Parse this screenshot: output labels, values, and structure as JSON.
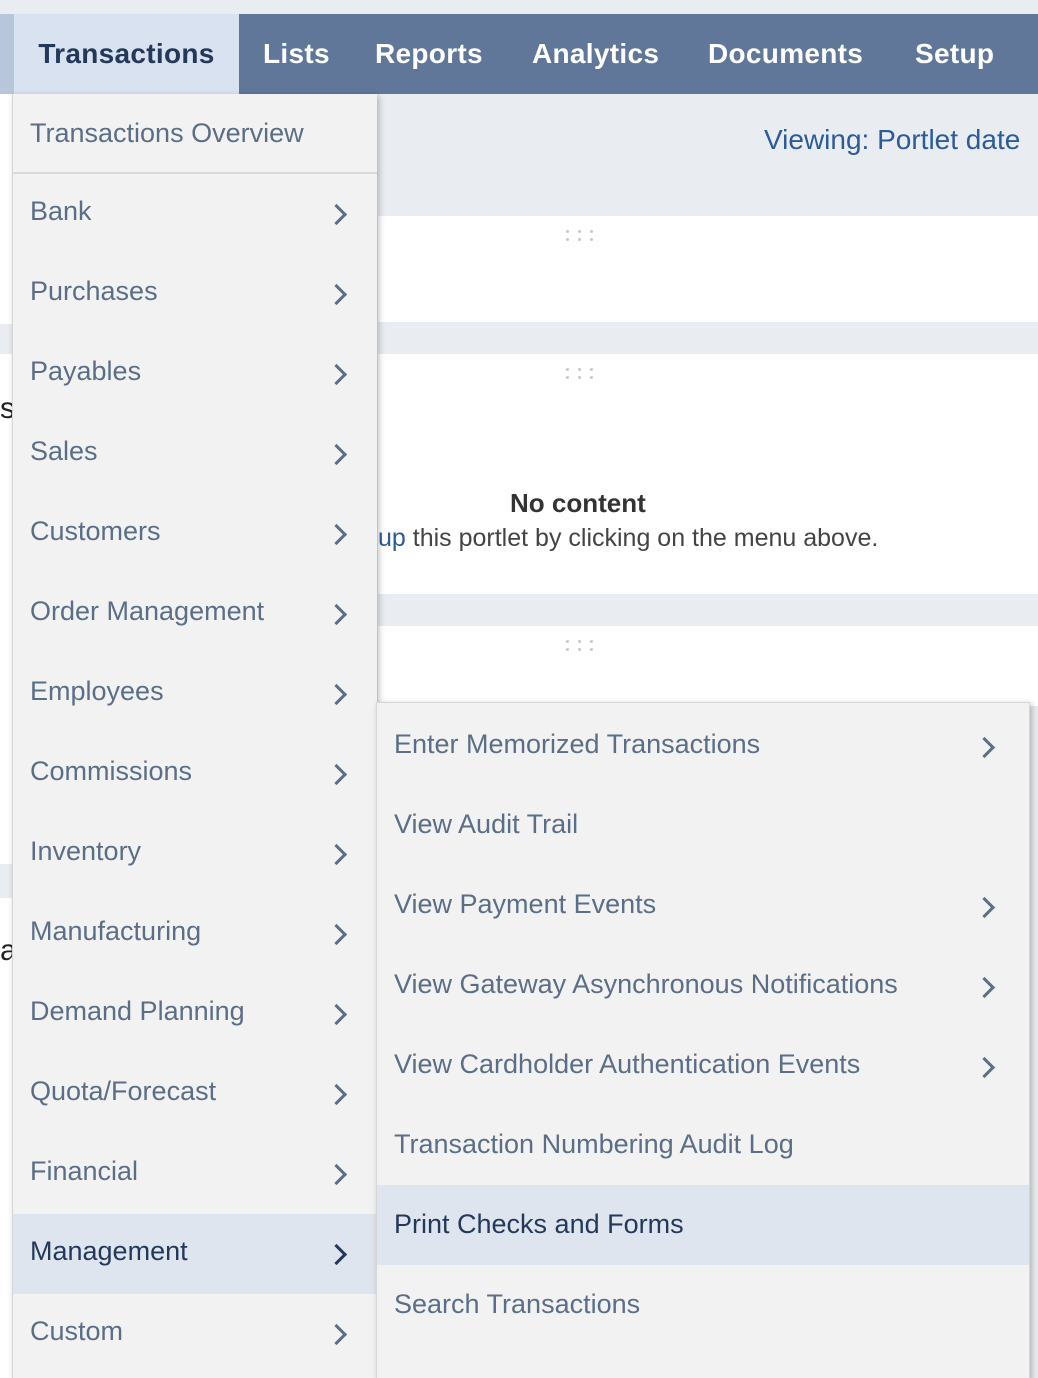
{
  "nav": {
    "tabs": [
      "Transactions",
      "Lists",
      "Reports",
      "Analytics",
      "Documents",
      "Setup"
    ],
    "active_tab": "Transactions"
  },
  "dashboard": {
    "viewing_label": "Viewing: Portlet date",
    "no_content_title": "No content",
    "hint_link_fragment": "up",
    "hint_text": " this portlet by clicking on the menu above."
  },
  "transactions_menu": {
    "overview": "Transactions Overview",
    "items": [
      {
        "label": "Bank",
        "has_submenu": true
      },
      {
        "label": "Purchases",
        "has_submenu": true
      },
      {
        "label": "Payables",
        "has_submenu": true
      },
      {
        "label": "Sales",
        "has_submenu": true
      },
      {
        "label": "Customers",
        "has_submenu": true
      },
      {
        "label": "Order Management",
        "has_submenu": true
      },
      {
        "label": "Employees",
        "has_submenu": true
      },
      {
        "label": "Commissions",
        "has_submenu": true
      },
      {
        "label": "Inventory",
        "has_submenu": true
      },
      {
        "label": "Manufacturing",
        "has_submenu": true
      },
      {
        "label": "Demand Planning",
        "has_submenu": true
      },
      {
        "label": "Quota/Forecast",
        "has_submenu": true
      },
      {
        "label": "Financial",
        "has_submenu": true
      },
      {
        "label": "Management",
        "has_submenu": true,
        "selected": true
      },
      {
        "label": "Custom",
        "has_submenu": true
      }
    ]
  },
  "management_submenu": {
    "items": [
      {
        "label": "Enter Memorized Transactions",
        "has_submenu": true
      },
      {
        "label": "View Audit Trail",
        "has_submenu": false
      },
      {
        "label": "View Payment Events",
        "has_submenu": true
      },
      {
        "label": "View Gateway Asynchronous Notifications",
        "has_submenu": true
      },
      {
        "label": "View Cardholder Authentication Events",
        "has_submenu": true
      },
      {
        "label": "Transaction Numbering Audit Log",
        "has_submenu": false
      },
      {
        "label": "Print Checks and Forms",
        "has_submenu": false,
        "highlighted": true
      },
      {
        "label": "Search Transactions",
        "has_submenu": false
      }
    ]
  },
  "colors": {
    "nav_bg": "#607799",
    "nav_active_bg": "#d8e2f0",
    "menu_bg": "#f2f2f2",
    "menu_text": "#5b6e86",
    "selected_bg": "#dfe5ee",
    "link": "#2c5b99"
  }
}
